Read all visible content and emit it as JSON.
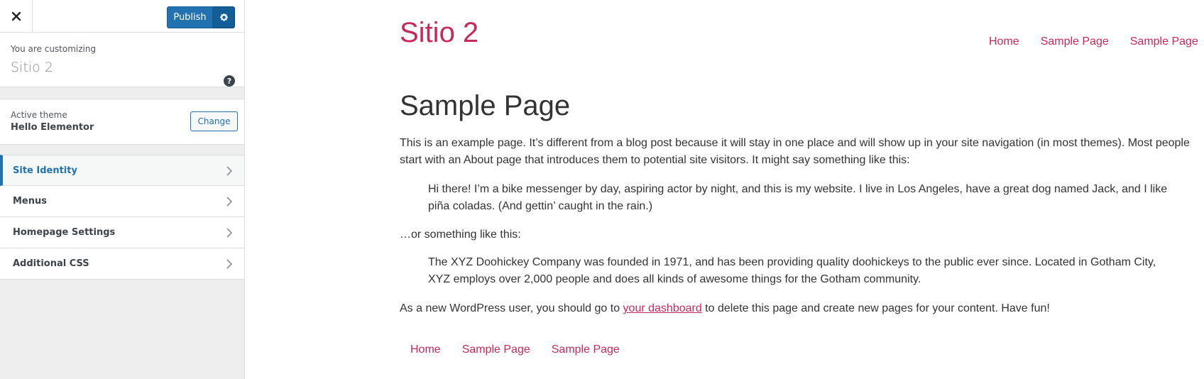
{
  "sidebar": {
    "publish_label": "Publish",
    "customizing_label": "You are customizing",
    "site_name": "Sitio 2",
    "help_glyph": "?",
    "theme": {
      "label": "Active theme",
      "name": "Hello Elementor",
      "change_label": "Change"
    },
    "items": [
      {
        "label": "Site Identity",
        "active": true
      },
      {
        "label": "Menus",
        "active": false
      },
      {
        "label": "Homepage Settings",
        "active": false
      },
      {
        "label": "Additional CSS",
        "active": false
      }
    ]
  },
  "preview": {
    "site_title": "Sitio 2",
    "nav": [
      "Home",
      "Sample Page",
      "Sample Page"
    ],
    "page_title": "Sample Page",
    "para1": "This is an example page. It’s different from a blog post because it will stay in one place and will show up in your site navigation (in most themes). Most people start with an About page that introduces them to potential site visitors. It might say something like this:",
    "quote1": "Hi there! I’m a bike messenger by day, aspiring actor by night, and this is my website. I live in Los Angeles, have a great dog named Jack, and I like piña coladas. (And gettin’ caught in the rain.)",
    "para2": "…or something like this:",
    "quote2": "The XYZ Doohickey Company was founded in 1971, and has been providing quality doohickeys to the public ever since. Located in Gotham City, XYZ employs over 2,000 people and does all kinds of awesome things for the Gotham community.",
    "para3_before": "As a new WordPress user, you should go to ",
    "para3_link": "your dashboard",
    "para3_after": " to delete this page and create new pages for your content. Have fun!",
    "footer_nav": [
      "Home",
      "Sample Page",
      "Sample Page"
    ]
  },
  "colors": {
    "accent": "#2271b1",
    "link": "#c9285a",
    "text": "#333333",
    "sidebar_bg": "#eeeeee"
  }
}
